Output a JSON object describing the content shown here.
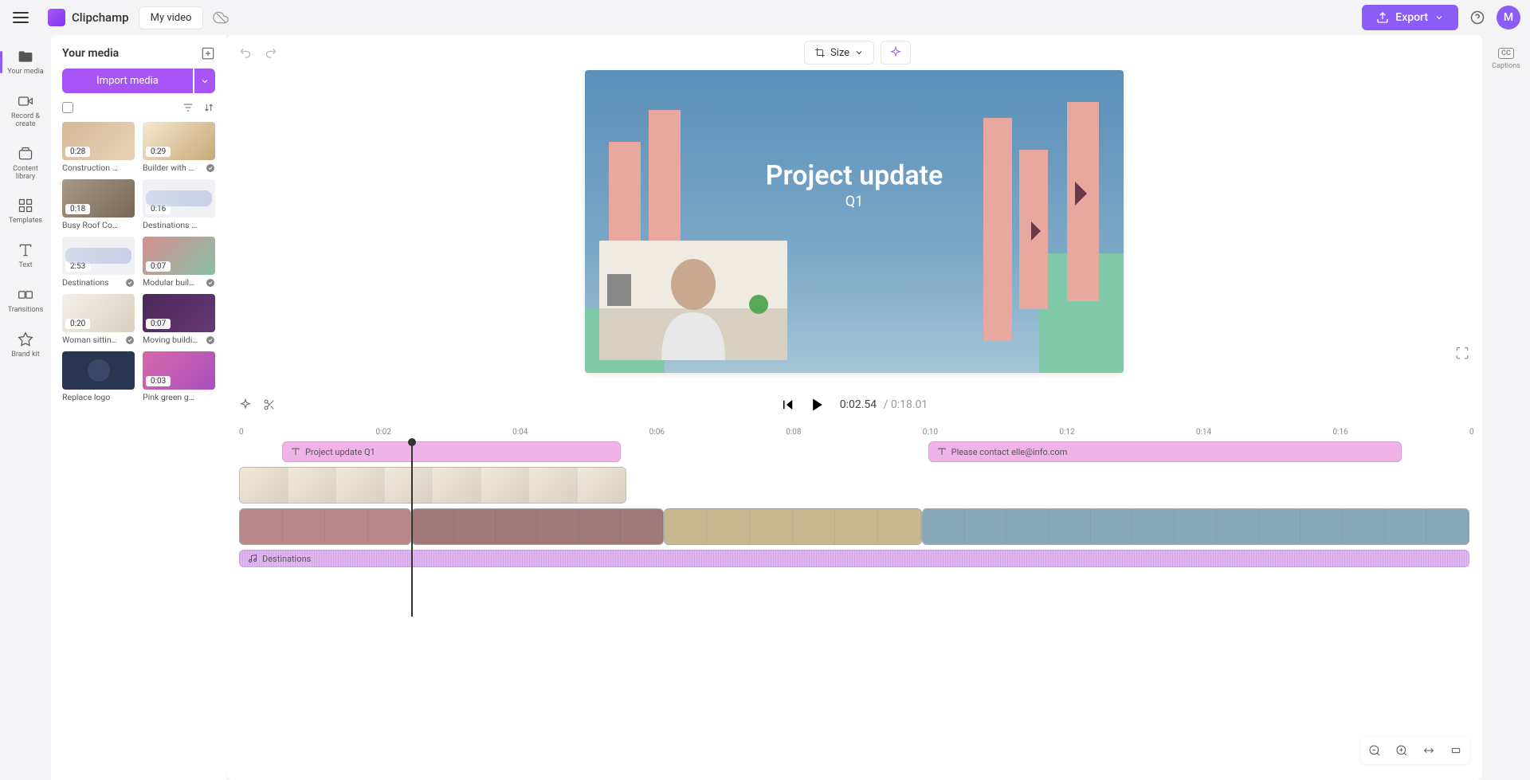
{
  "header": {
    "logo_text": "Clipchamp",
    "tab_name": "My video",
    "export_label": "Export",
    "avatar_letter": "M"
  },
  "leftrail": {
    "items": [
      {
        "label": "Your media",
        "icon": "folder"
      },
      {
        "label": "Record & create",
        "icon": "camera"
      },
      {
        "label": "Content library",
        "icon": "library"
      },
      {
        "label": "Templates",
        "icon": "templates"
      },
      {
        "label": "Text",
        "icon": "text"
      },
      {
        "label": "Transitions",
        "icon": "transitions"
      },
      {
        "label": "Brand kit",
        "icon": "brand"
      }
    ]
  },
  "media_panel": {
    "title": "Your media",
    "import_label": "Import media",
    "items": [
      {
        "duration": "0:28",
        "name": "Construction Wo…",
        "check": false,
        "thumb": "th-construction"
      },
      {
        "duration": "0:29",
        "name": "Builder with d…",
        "check": true,
        "thumb": "th-builder"
      },
      {
        "duration": "0:18",
        "name": "Busy Roof Const…",
        "check": false,
        "thumb": "th-roof"
      },
      {
        "duration": "0:16",
        "name": "Destinations (ou…",
        "check": false,
        "thumb": "th-audio1"
      },
      {
        "duration": "2:53",
        "name": "Destinations",
        "check": true,
        "thumb": "th-audio2"
      },
      {
        "duration": "0:07",
        "name": "Modular build…",
        "check": true,
        "thumb": "th-modular"
      },
      {
        "duration": "0:20",
        "name": "Woman sittin…",
        "check": true,
        "thumb": "th-woman"
      },
      {
        "duration": "0:07",
        "name": "Moving buildi…",
        "check": true,
        "thumb": "th-moving"
      },
      {
        "duration": "",
        "name": "Replace logo",
        "check": false,
        "thumb": "th-logo"
      },
      {
        "duration": "0:03",
        "name": "Pink green geo…",
        "check": false,
        "thumb": "th-pink"
      }
    ]
  },
  "toolbar": {
    "size_label": "Size"
  },
  "preview": {
    "title": "Project update",
    "subtitle": "Q1"
  },
  "playback": {
    "current_time": "0:02.54",
    "total_time": "0:18.01"
  },
  "timeline": {
    "ruler_ticks": [
      "0",
      "0:02",
      "0:04",
      "0:06",
      "0:08",
      "0:10",
      "0:12",
      "0:14",
      "0:16",
      "0"
    ],
    "playhead_pos_pct": 14,
    "text_clips": [
      {
        "label": "Project update Q1",
        "left_pct": 3.5,
        "width_pct": 27.5
      },
      {
        "label": "Please contact elle@info.com",
        "left_pct": 56,
        "width_pct": 38.5
      }
    ],
    "pip_clip": {
      "left_pct": 0,
      "width_pct": 31.5,
      "color": "#d8d0c0"
    },
    "video_clips": [
      {
        "left_pct": 0,
        "width_pct": 14,
        "color": "#b88888"
      },
      {
        "left_pct": 14,
        "width_pct": 20.5,
        "color": "#a07878"
      },
      {
        "left_pct": 34.5,
        "width_pct": 21,
        "color": "#c8b890"
      },
      {
        "left_pct": 55.5,
        "width_pct": 44.5,
        "color": "#88a8b8"
      }
    ],
    "audio_clip": {
      "label": "Destinations",
      "left_pct": 0,
      "width_pct": 100
    }
  },
  "rightrail": {
    "captions_label": "Captions",
    "cc_text": "CC"
  }
}
